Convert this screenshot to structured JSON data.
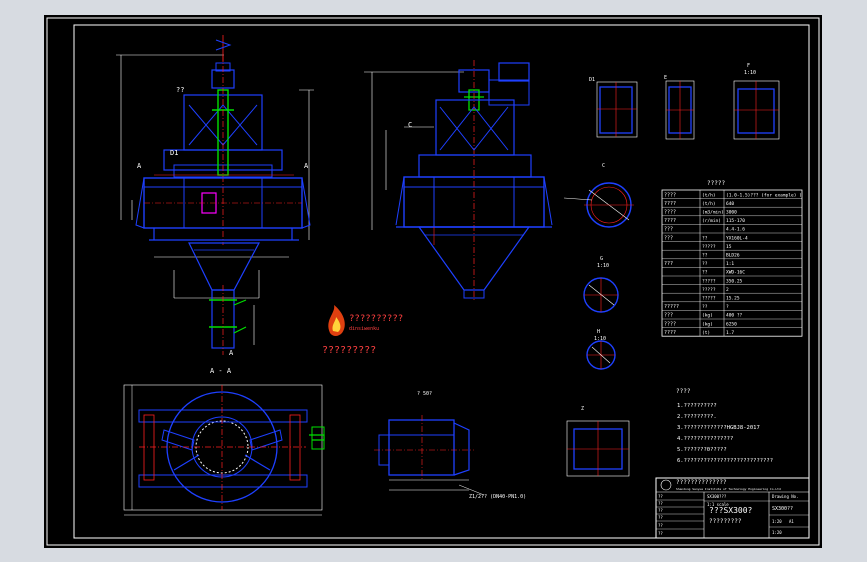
{
  "colors": {
    "background": "#000000",
    "frame": "#ffffff",
    "blue": "#1e40ff",
    "red": "#ff2020",
    "green": "#00e000",
    "yellow": "#ffff00",
    "cyan": "#00ffff",
    "margin": "#d7dbe1"
  },
  "front_view": {
    "label_top": "??",
    "label_d": "D1",
    "label_a_left": "A",
    "label_a_right": "A",
    "label_bottom": "A"
  },
  "side_view": {
    "label_c": "C"
  },
  "section_view": {
    "title": "A - A"
  },
  "detail_views": {
    "d1_title": "D1",
    "d1_scale": "1:10",
    "c_title": "C",
    "c_scale": "1:10",
    "e_title": "E",
    "e_scale": "1:10",
    "f_title": "F",
    "f_scale": "1:10",
    "g_title": "G",
    "g_scale": "1:10",
    "h_title": "H",
    "h_scale": "1:10",
    "bottom_title": "Z",
    "bottom_scale": "1:10",
    "nozzle_note": "Z1/2?? (DN40-PN1.0)",
    "box_note": "? 50?"
  },
  "logo": {
    "line1": "??????????",
    "line2": "dinsiwenku",
    "caption": "?????????"
  },
  "spec_table": {
    "title": "?????",
    "rows": [
      {
        "name": "????",
        "unit": "(t/h)",
        "value": "(1.0-1.5)??? (for  example) )"
      },
      {
        "name": "????",
        "unit": "(t/h)",
        "value": "640"
      },
      {
        "name": "????",
        "unit": "(m3/min)",
        "value": "3000"
      },
      {
        "name": "????",
        "unit": "(r/min)",
        "value": "115-170"
      },
      {
        "name": "???",
        "unit": "",
        "value": "4.4-1.6"
      },
      {
        "name": "???",
        "unit": "??",
        "value": "YX160L-4"
      },
      {
        "name": "",
        "unit": "?????",
        "value": "15"
      },
      {
        "name": "",
        "unit": "??",
        "value": "BLD26"
      },
      {
        "name": "???",
        "unit": "??",
        "value": "1:1"
      },
      {
        "name": "",
        "unit": "??",
        "value": "XWD-16C"
      },
      {
        "name": "",
        "unit": "?????",
        "value": "350.25"
      },
      {
        "name": "",
        "unit": "?????",
        "value": "2"
      },
      {
        "name": "",
        "unit": "?????",
        "value": "15.25"
      },
      {
        "name": "?????",
        "unit": "??",
        "value": "?"
      },
      {
        "name": "???",
        "unit": "(kg)",
        "value": "400   ??"
      },
      {
        "name": "????",
        "unit": "(kg)",
        "value": "6250"
      },
      {
        "name": "????",
        "unit": "(t)",
        "value": "1.7"
      }
    ]
  },
  "notes": {
    "title": "????",
    "items": [
      "1.??????????",
      "2.?????????.",
      "3.?????????????HGBJ8-2017",
      "4.???????????????",
      "5.???????0?????",
      "6.???????????????????????????"
    ]
  },
  "title_block": {
    "company": "??????????????",
    "company_en": "Shandong Sanyue Institute of Technology Engineering Co.Ltd",
    "drawing_name": "???SX300?",
    "drawing_sub": "?????????",
    "code": "SX300??",
    "row_labels": [
      "??",
      "??",
      "??",
      "??",
      "??",
      "??"
    ],
    "cells": [
      "SX300???",
      "Drawing No.",
      "1:1 scale",
      "1:20",
      "A1",
      "1:20"
    ]
  }
}
